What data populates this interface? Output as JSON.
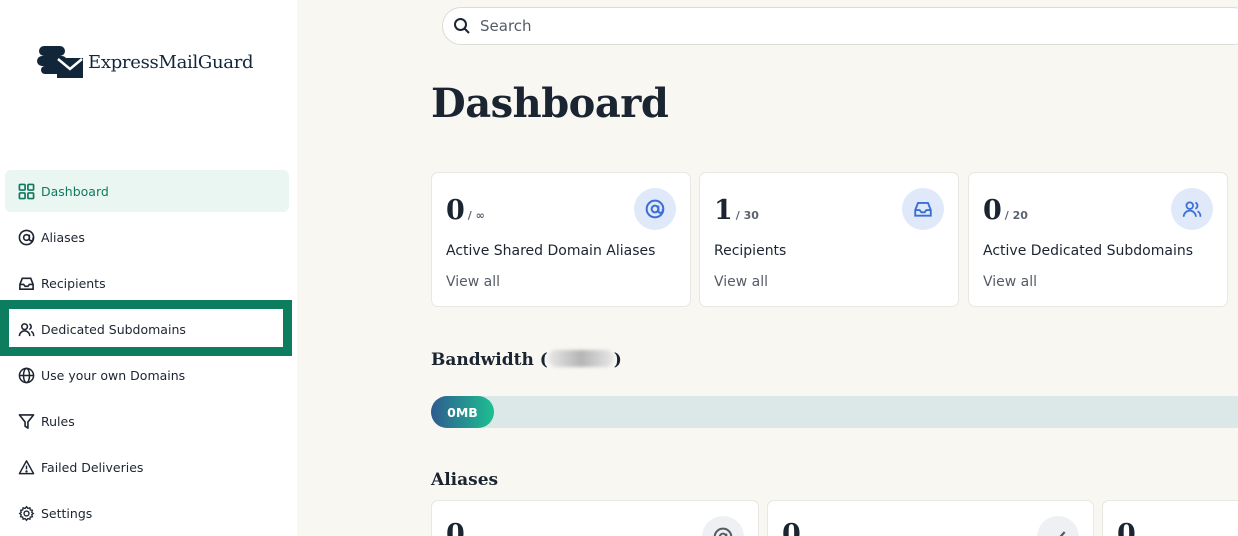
{
  "brand": {
    "name": "ExpressMailGuard"
  },
  "colors": {
    "accent": "#0f7a5e",
    "highlight": "#0d7d5f",
    "icon_blue": "#3b6fd6"
  },
  "sidebar": {
    "items": [
      {
        "label": "Dashboard",
        "icon": "grid-icon",
        "active": true
      },
      {
        "label": "Aliases",
        "icon": "at-sign-icon"
      },
      {
        "label": "Recipients",
        "icon": "inbox-icon"
      },
      {
        "label": "Dedicated Subdomains",
        "icon": "users-icon",
        "highlighted": true
      },
      {
        "label": "Use your own Domains",
        "icon": "globe-icon"
      },
      {
        "label": "Rules",
        "icon": "filter-icon"
      },
      {
        "label": "Failed Deliveries",
        "icon": "warning-triangle-icon"
      },
      {
        "label": "Settings",
        "icon": "gear-icon"
      }
    ]
  },
  "search": {
    "placeholder": "Search"
  },
  "page": {
    "title": "Dashboard"
  },
  "stats": [
    {
      "value": "0",
      "limit": "/ ∞",
      "label": "Active Shared Domain Aliases",
      "link": "View all",
      "icon": "at-sign-icon"
    },
    {
      "value": "1",
      "limit": "/ 30",
      "label": "Recipients",
      "link": "View all",
      "icon": "inbox-icon"
    },
    {
      "value": "0",
      "limit": "/ 20",
      "label": "Active Dedicated Subdomains",
      "link": "View all",
      "icon": "users-icon"
    }
  ],
  "bandwidth": {
    "title_prefix": "Bandwidth (",
    "title_suffix": ")",
    "used_label": "0MB"
  },
  "aliases": {
    "title": "Aliases",
    "cards": [
      {
        "value": "0",
        "icon": "at-sign-icon"
      },
      {
        "value": "0",
        "icon": "check-icon"
      },
      {
        "value": "0"
      }
    ]
  }
}
